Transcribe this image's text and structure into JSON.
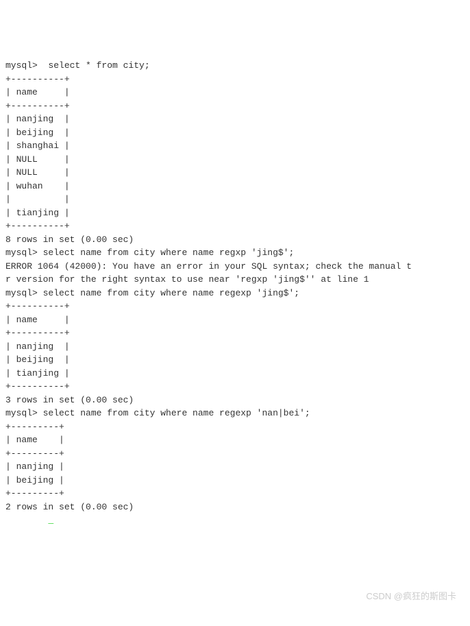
{
  "prompt": "mysql>",
  "query1": {
    "cmd": " select * from city;",
    "border": "+----------+",
    "header": "| name     |",
    "rows": [
      "| nanjing  |",
      "| beijing  |",
      "| shanghai |",
      "| NULL     |",
      "| NULL     |",
      "| wuhan    |",
      "|          |",
      "| tianjing |"
    ],
    "footer": "8 rows in set (0.00 sec)"
  },
  "query2": {
    "cmd": "select name from city where name regxp 'jing$';",
    "error": "ERROR 1064 (42000): You have an error in your SQL syntax; check the manual t\nr version for the right syntax to use near 'regxp 'jing$'' at line 1"
  },
  "query3": {
    "cmd": "select name from city where name regexp 'jing$';",
    "border": "+----------+",
    "header": "| name     |",
    "rows": [
      "| nanjing  |",
      "| beijing  |",
      "| tianjing |"
    ],
    "footer": "3 rows in set (0.00 sec)"
  },
  "query4": {
    "cmd": "select name from city where name regexp 'nan|bei';",
    "border": "+---------+",
    "header": "| name    |",
    "rows": [
      "| nanjing |",
      "| beijing |"
    ],
    "footer": "2 rows in set (0.00 sec)"
  },
  "watermark": "CSDN @疯狂的斯图卡",
  "cursor_block": "_"
}
